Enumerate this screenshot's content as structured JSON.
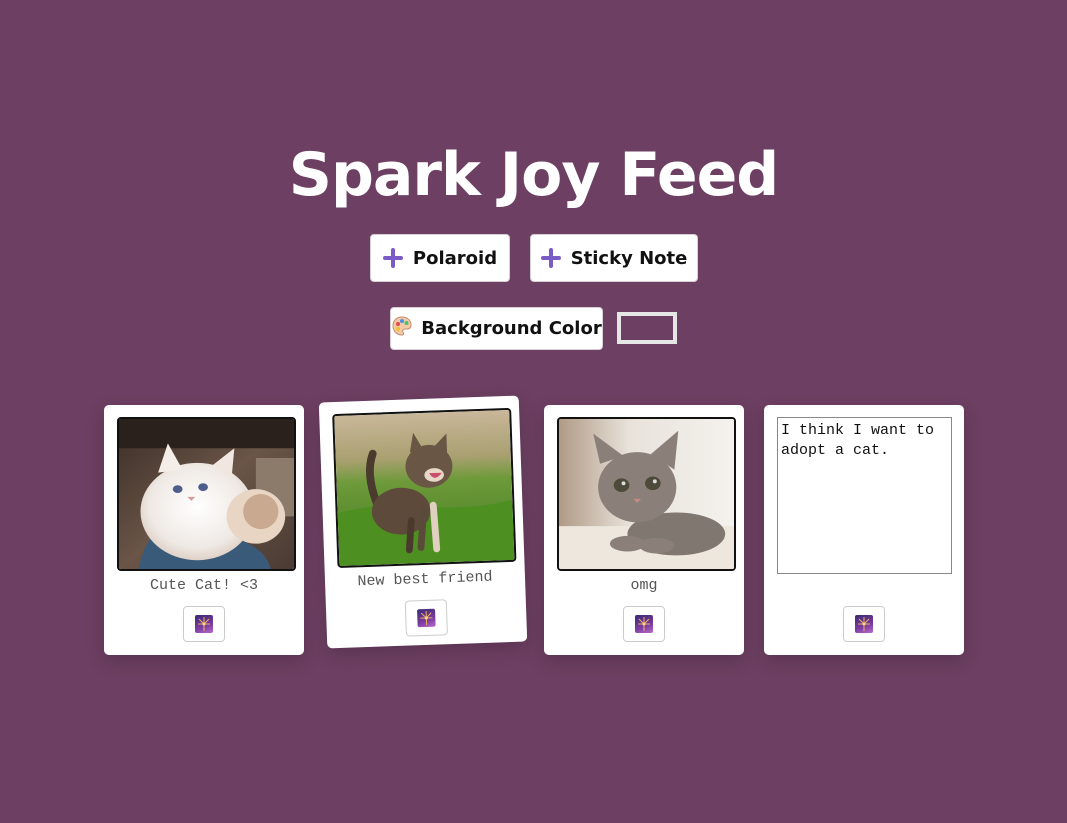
{
  "page": {
    "title": "Spark Joy Feed",
    "background_color": "#6d3f62"
  },
  "toolbar": {
    "add_polaroid_label": "Polaroid",
    "add_sticky_note_label": "Sticky Note",
    "background_color_label": "Background Color",
    "plus_icon": "plus-icon",
    "palette_icon": "palette-icon",
    "accent_color": "#7b5cc7"
  },
  "cards": [
    {
      "type": "polaroid",
      "caption": "Cute Cat! <3",
      "photo_subject": "white fluffy kitten held on lap"
    },
    {
      "type": "polaroid",
      "caption": "New best friend",
      "photo_subject": "tabby kitten meowing on grass"
    },
    {
      "type": "polaroid",
      "caption": "omg",
      "photo_subject": "grey tabby kitten lying on blanket"
    },
    {
      "type": "sticky-note",
      "text": "I think I want to adopt a cat."
    }
  ],
  "spark_icon": "sparkle-icon"
}
